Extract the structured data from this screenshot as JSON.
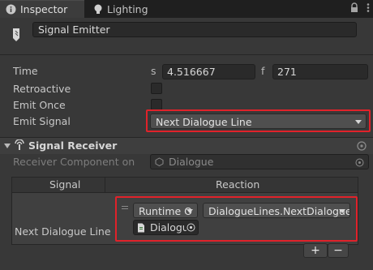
{
  "tabs": [
    {
      "label": "Inspector",
      "icon": "info-icon",
      "active": true
    },
    {
      "label": "Lighting",
      "icon": "lightbulb-icon",
      "active": false
    }
  ],
  "header": {
    "object_name": "Signal Emitter"
  },
  "properties": {
    "time": {
      "label": "Time",
      "s_label": "s",
      "s_value": "4.516667",
      "f_label": "f",
      "f_value": "271"
    },
    "retroactive": {
      "label": "Retroactive"
    },
    "emit_once": {
      "label": "Emit Once"
    },
    "emit_signal": {
      "label": "Emit Signal",
      "value": "Next Dialogue Line"
    }
  },
  "receiver": {
    "section_title": "Signal Receiver",
    "component_label": "Receiver Component on",
    "component_value": "Dialogue",
    "columns": [
      "Signal",
      "Reaction"
    ],
    "row": {
      "signal": "Next Dialogue Line",
      "runtime": "Runtime O",
      "method": "DialogueLines.NextDialogueL",
      "target": "Dialogu"
    },
    "add_label": "+",
    "remove_label": "−"
  },
  "colors": {
    "highlight": "#e0222a",
    "background": "#383838"
  }
}
